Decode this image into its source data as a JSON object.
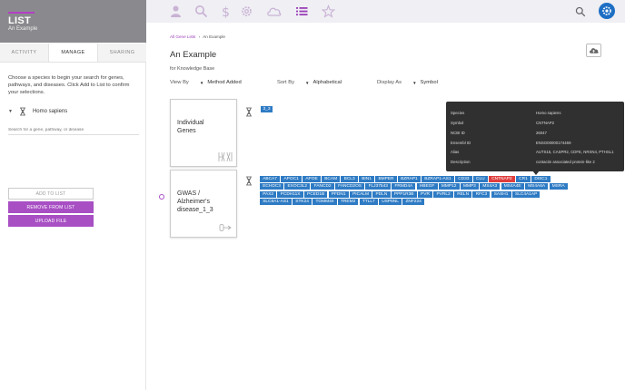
{
  "sidebar": {
    "title": "LIST",
    "subtitle": "An Example",
    "tabs": [
      "ACTIVITY",
      "MANAGE",
      "SHARING"
    ],
    "instructions": "Choose a species to begin your search for genes, pathways, and diseases. Click Add to List to confirm your selections.",
    "species": "Homo sapiens",
    "search_placeholder": "Search for a gene, pathway, or disease",
    "add_label": "ADD TO LIST",
    "remove_label": "REMOVE FROM LIST",
    "upload_label": "UPLOAD FILE"
  },
  "topbar": {
    "icons": [
      "user-icon",
      "search-icon",
      "dollar-icon",
      "gear-icon",
      "cloud-icon",
      "list-icon",
      "star-icon",
      "search-icon",
      "profile-icon"
    ],
    "active": "list-icon",
    "colors": {
      "active": "#9c3fb8",
      "inactive": "#c9b2d4",
      "avatar": "#1e6fc4"
    }
  },
  "main": {
    "breadcrumb": {
      "link": "All Gene Lists",
      "sep": "›",
      "current": "An Example"
    },
    "title": "An Example",
    "subtitle": "for Knowledge Base",
    "view_by": {
      "label": "View By",
      "value": "Method Added"
    },
    "sort_by": {
      "label": "Sort By",
      "value": "Alphabetical"
    },
    "display_as": {
      "label": "Display As",
      "value": "Symbol"
    },
    "cards": [
      {
        "title": "Individual Genes"
      },
      {
        "title": "GWAS / Alzheimer's disease_1_3"
      }
    ],
    "individual_genes": [
      "3_3"
    ],
    "gwas_genes": [
      "ABCA7",
      "APOC1",
      "APOE",
      "BCAM",
      "BCL3",
      "BIN1",
      "BMPER",
      "BZRAP1",
      "BZRAP1-AS1",
      "CD33",
      "CLU",
      "CNTNAP2",
      "CR1",
      "DISC1",
      "ECHDC3",
      "EXOC3L2",
      "FANCD2",
      "FANCD2OS",
      "FLJ37543",
      "FRMD4A",
      "HBEGF",
      "MMP12",
      "MMP3",
      "MS4A3",
      "MS4A4E",
      "MS4A6A",
      "MSRA",
      "PAX2",
      "PCDH11X",
      "PCED1B",
      "PFDN1",
      "PICALM",
      "PDLN",
      "PPP1R3B",
      "PVR",
      "PVRL2",
      "RELN",
      "RFC3",
      "SASH1",
      "SLC4A1AP",
      "SLC8A1-AS1",
      "STK24",
      "TOMM40",
      "TREM2",
      "TTLL7",
      "USP6NL",
      "ZNF224"
    ],
    "selected_gene": "CNTNAP2",
    "gene_color": "#2e7bc4",
    "selected_color": "#e03e3e"
  },
  "tooltip": {
    "rows": [
      {
        "k": "Species",
        "v": "Homo sapiens"
      },
      {
        "k": "Symbol",
        "v": "CNTNAP2"
      },
      {
        "k": "NCBI ID",
        "v": "26047"
      },
      {
        "k": "Ensembl ID",
        "v": "ENSG00000174469"
      },
      {
        "k": "Alias",
        "v": "AUTS15, CASPR2, CDFE, NRXN4, PTHSL1"
      },
      {
        "k": "Description",
        "v": "contactin associated protein-like 2"
      }
    ]
  }
}
